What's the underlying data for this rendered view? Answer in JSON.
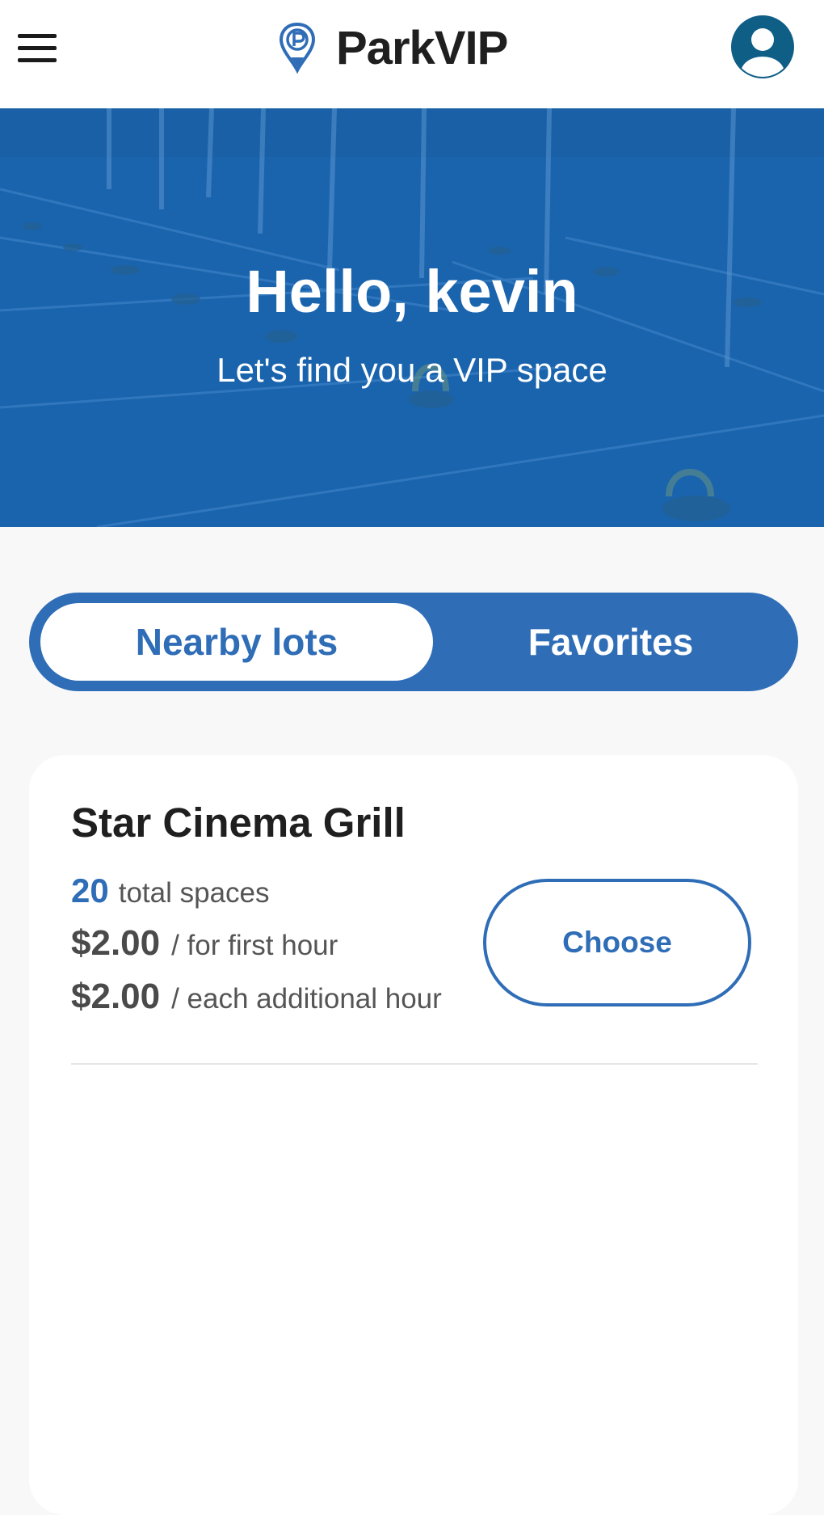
{
  "app": {
    "name": "ParkVIP",
    "colors": {
      "primary": "#2f6db7",
      "hero": "#1b64ae",
      "avatar": "#0f5e86",
      "text": "#1f1f1f"
    }
  },
  "header": {
    "menu_icon": "hamburger-menu-icon",
    "logo_icon": "parking-pin-icon",
    "profile_icon": "user-avatar-icon"
  },
  "hero": {
    "greeting": "Hello, kevin",
    "subtitle": "Let's find you a VIP space"
  },
  "tabs": [
    {
      "label": "Nearby lots",
      "active": true
    },
    {
      "label": "Favorites",
      "active": false
    }
  ],
  "lots": [
    {
      "name": "Star Cinema Grill",
      "total_spaces": "20",
      "total_spaces_label": "total spaces",
      "first_hour_price": "$2.00",
      "first_hour_label": "/ for first hour",
      "additional_hour_price": "$2.00",
      "additional_hour_label": "/ each additional hour",
      "action_label": "Choose"
    }
  ]
}
